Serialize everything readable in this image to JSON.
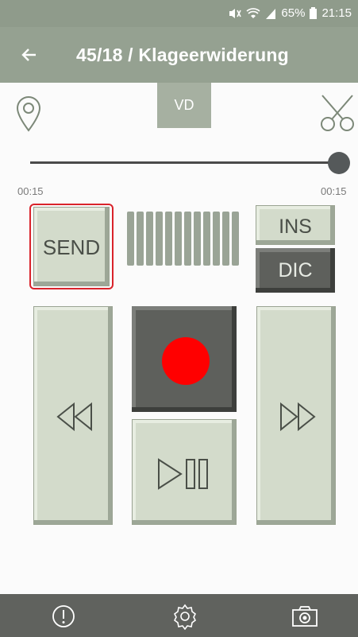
{
  "status_bar": {
    "battery": "65%",
    "time": "21:15",
    "icons": [
      "mute-vibrate-icon",
      "wifi-icon",
      "signal-icon",
      "battery-icon"
    ]
  },
  "app_bar": {
    "back_icon": "arrow-left-icon",
    "title": "45/18 / Klageerwiderung"
  },
  "toolbar": {
    "left_icon": "location-pin-icon",
    "tab_label": "VD",
    "right_icon": "scissors-icon"
  },
  "playback": {
    "position_fraction": 1.0,
    "time_left": "00:15",
    "time_right": "00:15"
  },
  "controls": {
    "send_label": "SEND",
    "ins_label": "INS",
    "dic_label": "DIC",
    "level_bar_count": 12,
    "rewind_icon": "rewind-icon",
    "record_icon": "record-icon",
    "play_pause_icon": "play-pause-icon",
    "fast_forward_icon": "fast-forward-icon"
  },
  "bottom_bar": {
    "icons": [
      "info-icon",
      "settings-icon",
      "camera-icon"
    ]
  },
  "colors": {
    "app_bar": "#95a191",
    "button_light": "#d3dbcb",
    "button_dark": "#5e605c",
    "record": "#ff0000",
    "send_highlight": "#d9232b"
  }
}
